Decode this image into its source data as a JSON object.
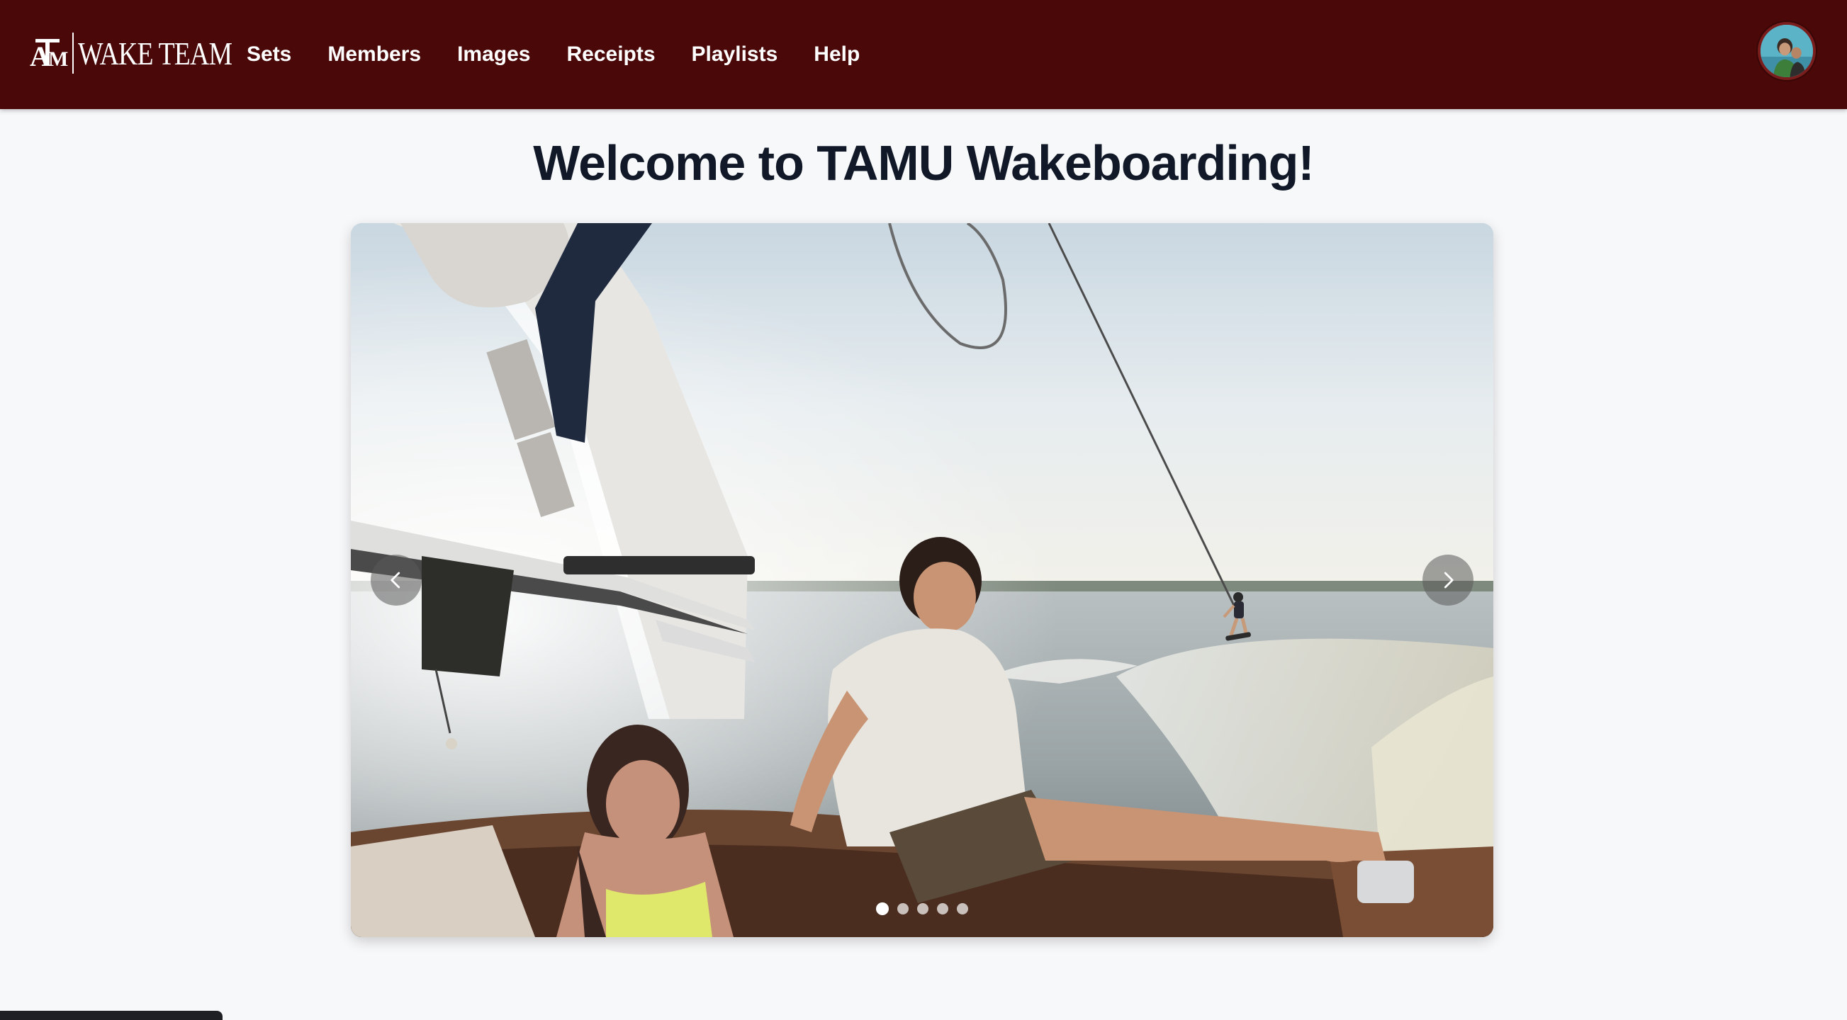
{
  "header": {
    "logo_text": "WAKE TEAM",
    "nav": [
      {
        "label": "Sets"
      },
      {
        "label": "Members"
      },
      {
        "label": "Images"
      },
      {
        "label": "Receipts"
      },
      {
        "label": "Playlists"
      },
      {
        "label": "Help"
      }
    ]
  },
  "main": {
    "title": "Welcome to TAMU Wakeboarding!"
  },
  "carousel": {
    "slide_count": 5,
    "active_slide": 1
  },
  "colors": {
    "navbar": "#4a0808",
    "title": "#111827",
    "background": "#f7f8fa"
  },
  "icons": {
    "prev": "chevron-left-icon",
    "next": "chevron-right-icon"
  }
}
